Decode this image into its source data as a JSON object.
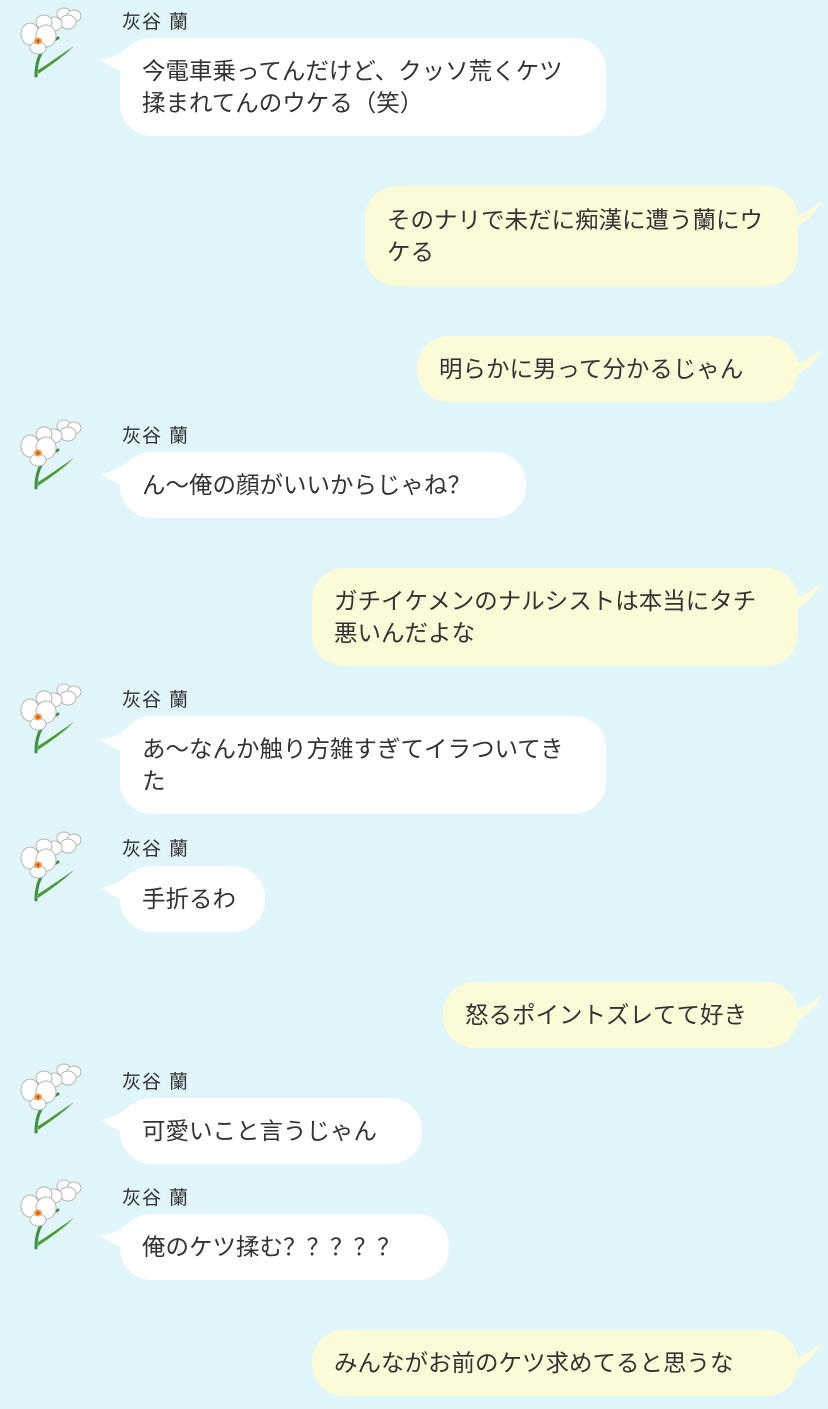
{
  "sender_name": "灰谷 蘭",
  "messages": [
    {
      "side": "in",
      "text": "今電車乗ってんだけど、クッソ荒くケツ揉まれてんのウケる（笑）"
    },
    {
      "side": "out",
      "text": "そのナリで未だに痴漢に遭う蘭にウケる"
    },
    {
      "side": "out",
      "text": "明らかに男って分かるじゃん"
    },
    {
      "side": "in",
      "text": "ん〜俺の顔がいいからじゃね？"
    },
    {
      "side": "out",
      "text": "ガチイケメンのナルシストは本当にタチ悪いんだよな"
    },
    {
      "side": "in",
      "text": "あ〜なんか触り方雑すぎてイラついてきた"
    },
    {
      "side": "in",
      "text": "手折るわ"
    },
    {
      "side": "out",
      "text": "怒るポイントズレてて好き"
    },
    {
      "side": "in",
      "text": "可愛いこと言うじゃん"
    },
    {
      "side": "in",
      "text": "俺のケツ揉む？？？？？"
    },
    {
      "side": "out",
      "text": "みんながお前のケツ求めてると思うな"
    }
  ]
}
